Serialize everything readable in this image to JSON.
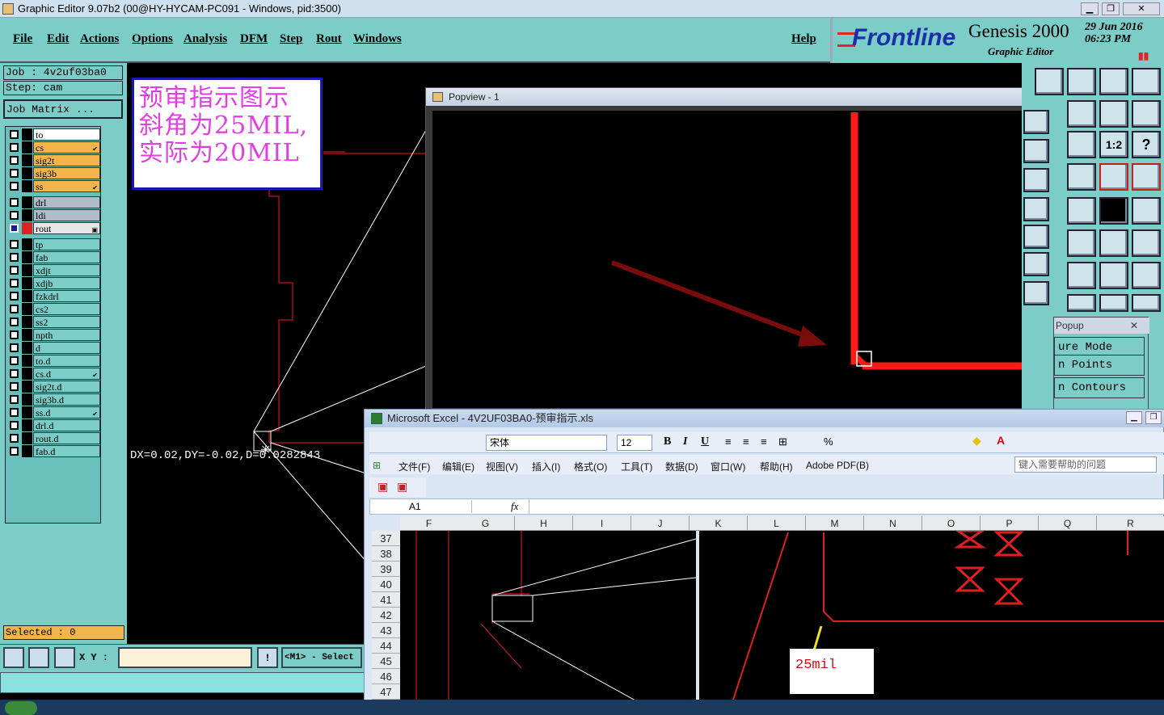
{
  "window": {
    "title": "Graphic Editor 9.07b2 (00@HY-HYCAM-PC091 - Windows, pid:3500)"
  },
  "menu": {
    "items": [
      "File",
      "Edit",
      "Actions",
      "Options",
      "Analysis",
      "DFM",
      "Step",
      "Rout",
      "Windows"
    ],
    "help": "Help"
  },
  "brand": {
    "logo": "Frontline",
    "product": "Genesis 2000",
    "subtitle": "Graphic Editor",
    "date": "29 Jun 2016",
    "time": "06:23 PM"
  },
  "job": {
    "job_label": "Job : 4v2uf03ba0",
    "step_label": "Step: cam",
    "matrix_button": "Job Matrix ..."
  },
  "layers": [
    {
      "name": "to",
      "color": "#ffffff"
    },
    {
      "name": "cs",
      "color": "#f3b54a",
      "mark": "✔"
    },
    {
      "name": "sig2t",
      "color": "#f3b54a"
    },
    {
      "name": "sig3b",
      "color": "#f3b54a"
    },
    {
      "name": "ss",
      "color": "#f3b54a",
      "mark": "✔"
    },
    {
      "name": "drl",
      "color": "#b0bcc8"
    },
    {
      "name": "ldi",
      "color": "#b0bcc8"
    },
    {
      "name": "rout",
      "color": "#e6e6e6",
      "active": true,
      "mark": "▣"
    },
    {
      "name": "tp",
      "color": "#7cccc8"
    },
    {
      "name": "fab",
      "color": "#7cccc8"
    },
    {
      "name": "xdjt",
      "color": "#7cccc8"
    },
    {
      "name": "xdjb",
      "color": "#7cccc8"
    },
    {
      "name": "fzkdrl",
      "color": "#7cccc8"
    },
    {
      "name": "cs2",
      "color": "#7cccc8"
    },
    {
      "name": "ss2",
      "color": "#7cccc8"
    },
    {
      "name": "npth",
      "color": "#7cccc8"
    },
    {
      "name": "d",
      "color": "#7cccc8"
    },
    {
      "name": "to.d",
      "color": "#7cccc8"
    },
    {
      "name": "cs.d",
      "color": "#7cccc8",
      "mark": "✔"
    },
    {
      "name": "sig2t.d",
      "color": "#7cccc8"
    },
    {
      "name": "sig3b.d",
      "color": "#7cccc8"
    },
    {
      "name": "ss.d",
      "color": "#7cccc8",
      "mark": "✔"
    },
    {
      "name": "drl.d",
      "color": "#7cccc8"
    },
    {
      "name": "rout.d",
      "color": "#7cccc8"
    },
    {
      "name": "fab.d",
      "color": "#7cccc8"
    }
  ],
  "status": {
    "selected": "Selected : 0",
    "xy_label": "X Y :",
    "xy_value": "",
    "mouse_hint": "<M1> - Select"
  },
  "canvas": {
    "measure": "DX=0.02,DY=-0.02,D=0.0282843"
  },
  "note": {
    "lines": [
      "预审指示图示",
      "斜角为25MIL,",
      "实际为20MIL"
    ]
  },
  "popview": {
    "title": "Popview - 1"
  },
  "popup": {
    "title": "Popup",
    "rows": [
      "ure Mode",
      "n Points",
      "n Contours"
    ]
  },
  "excel": {
    "title": "Microsoft Excel - 4V2UF03BA0-预审指示.xls",
    "font": "宋体",
    "size": "12",
    "menu": [
      "文件(F)",
      "编辑(E)",
      "视图(V)",
      "插入(I)",
      "格式(O)",
      "工具(T)",
      "数据(D)",
      "窗口(W)",
      "帮助(H)",
      "Adobe PDF(B)"
    ],
    "help_box": "键入需要帮助的问题",
    "cell_ref": "A1",
    "fx": "fx",
    "columns": [
      "F",
      "G",
      "H",
      "I",
      "J",
      "K",
      "L",
      "M",
      "N",
      "O",
      "P",
      "Q",
      "R"
    ],
    "rows": [
      "37",
      "38",
      "39",
      "40",
      "41",
      "42",
      "43",
      "44",
      "45",
      "46",
      "47"
    ],
    "callout": "25mil"
  },
  "colors": {
    "teal": "#7cccc8",
    "trace": "#ff1a1a"
  }
}
